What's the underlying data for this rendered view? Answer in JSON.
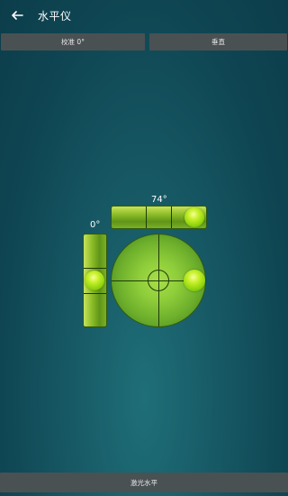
{
  "header": {
    "back_icon": "arrow-left-icon",
    "title": "水平仪"
  },
  "toolbar": {
    "calibrate_label": "校准 0°",
    "vertical_label": "垂直"
  },
  "level": {
    "horizontal_reading": "74°",
    "vertical_reading": "0°"
  },
  "footer": {
    "laser_label": "激光水平"
  },
  "colors": {
    "background": "#124a57",
    "button": "#4a5153",
    "bubble": "#c7f02a",
    "level_body": "#8fbf2a"
  }
}
